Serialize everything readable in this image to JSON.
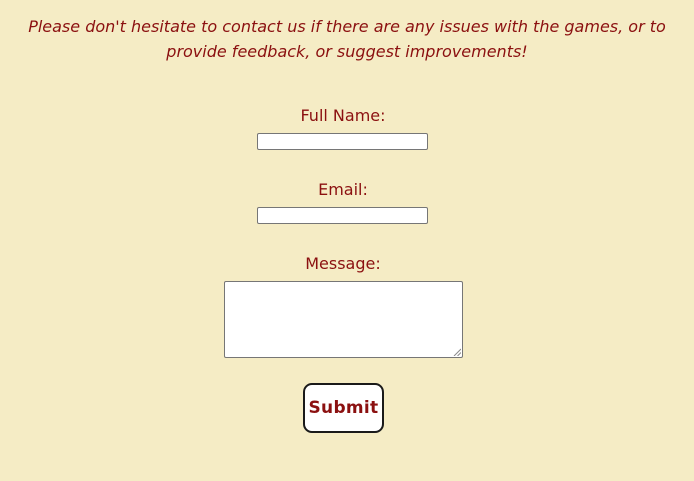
{
  "intro_text": "Please don't hesitate to contact us if there are any issues with the games, or to provide feedback, or suggest improvements!",
  "form": {
    "full_name_label": "Full Name:",
    "full_name_value": "",
    "email_label": "Email:",
    "email_value": "",
    "message_label": "Message:",
    "message_value": "",
    "submit_label": "Submit"
  },
  "colors": {
    "background": "#f5ecc5",
    "text": "#8b1010",
    "input_border": "#767676",
    "button_border": "#1a1a1a"
  }
}
